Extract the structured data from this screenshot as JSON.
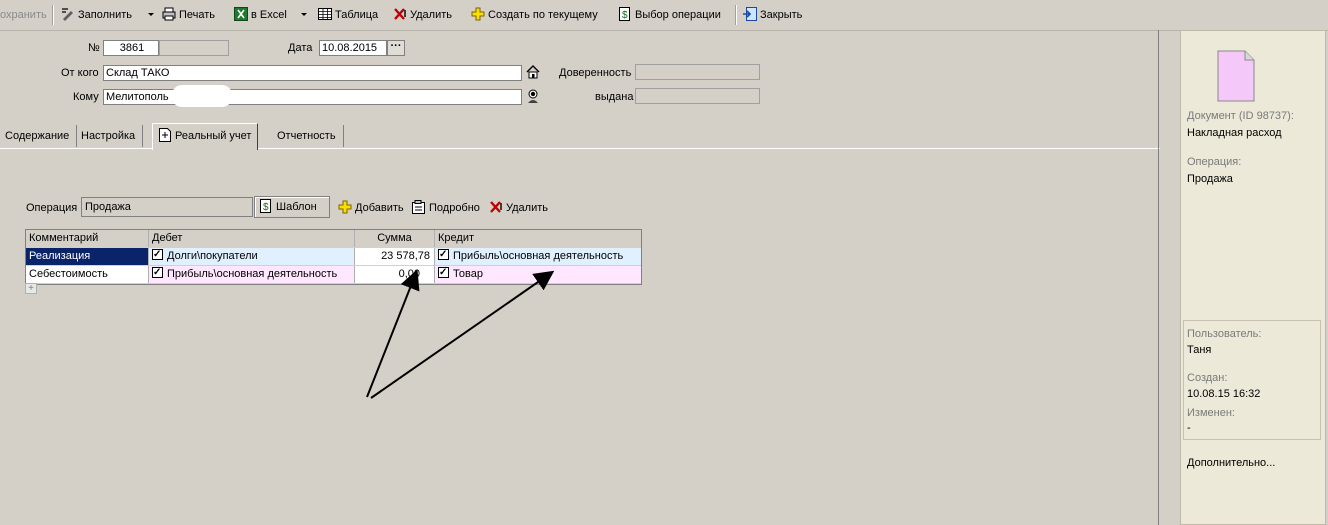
{
  "toolbar": {
    "save": "охранить",
    "fill": "Заполнить",
    "print": "Печать",
    "excel": "в Excel",
    "table": "Таблица",
    "delete": "Удалить",
    "create": "Создать по текущему",
    "select_op": "Выбор операции",
    "close": "Закрыть"
  },
  "header": {
    "number_label": "№",
    "number_value": "3861",
    "date_label": "Дата",
    "date_value": "10.08.2015",
    "date_button": "···",
    "from_label": "От кого",
    "from_value": "Склад ТАКО",
    "to_label": "Кому",
    "to_value": "Мелитополь ,Г",
    "trust_label": "Доверенность",
    "issued_label": "выдана"
  },
  "tabs": [
    "Содержание",
    "Настройка",
    "Реальный учет",
    "Отчетность"
  ],
  "operation": {
    "label": "Операция",
    "value": "Продажа",
    "template_btn": "Шаблон",
    "add": "Добавить",
    "details": "Подробно",
    "delete": "Удалить"
  },
  "grid": {
    "headers": [
      "Комментарий",
      "Дебет",
      "Сумма",
      "Кредит"
    ],
    "rows": [
      {
        "comment": "Реализация",
        "debit": "Долги\\покупатели",
        "sum": "23 578,78",
        "credit": "Прибыль\\основная деятельность"
      },
      {
        "comment": "Себестоимость",
        "debit": "Прибыль\\основная деятельность",
        "sum": "0,00",
        "credit": "Товар"
      }
    ],
    "add_row": "+"
  },
  "side": {
    "doc_label": "Документ",
    "doc_id": "(ID 98737):",
    "doc_value": "Накладная расход",
    "op_label": "Операция:",
    "op_value": "Продажа",
    "user_label": "Пользователь:",
    "user_value": "Таня",
    "created_label": "Создан:",
    "created_value": "10.08.15  16:32",
    "changed_label": "Изменен:",
    "changed_value": "-",
    "more": "Дополнительно..."
  },
  "colors": {
    "selected_row": "#0a246a",
    "debit_bg": "#e0f0ff",
    "credit_bg": "#ffe8ff",
    "doc_icon": "#f4c8f8"
  }
}
